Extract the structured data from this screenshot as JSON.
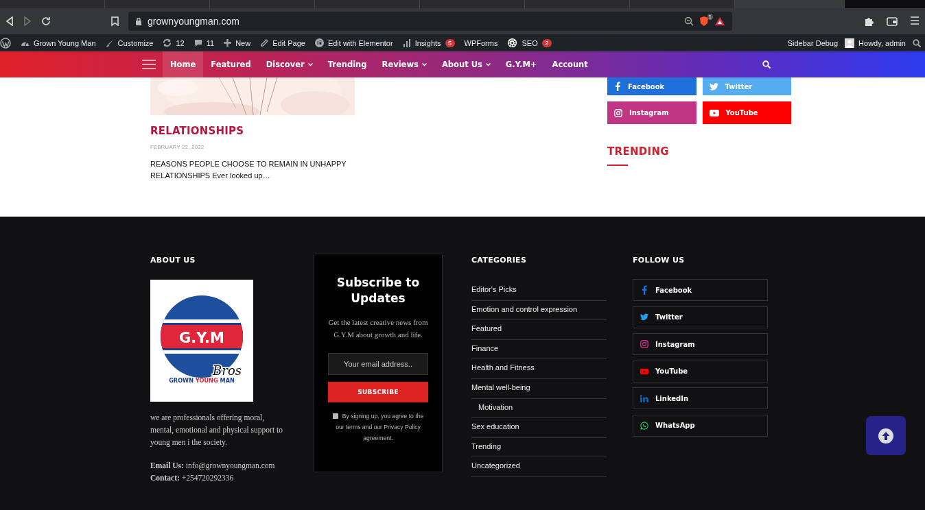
{
  "browser": {
    "tabs": [
      {
        "selected": false
      },
      {
        "selected": false
      },
      {
        "selected": false
      },
      {
        "selected": false
      },
      {
        "selected": false
      },
      {
        "selected": false
      },
      {
        "selected": false
      },
      {
        "selected": true
      }
    ],
    "address": "grownyoungman.com",
    "shield_badge": "1"
  },
  "admin_bar": {
    "items": [
      {
        "kind": "wordpress"
      },
      {
        "kind": "gauge",
        "label": "Grown Young Man"
      },
      {
        "kind": "brush",
        "label": "Customize"
      },
      {
        "kind": "refresh",
        "label": "12"
      },
      {
        "kind": "comment",
        "label": "11"
      },
      {
        "kind": "plus",
        "label": "New"
      },
      {
        "kind": "pencil",
        "label": "Edit Page"
      },
      {
        "kind": "elementor",
        "label": "Edit with Elementor"
      },
      {
        "kind": "bars",
        "label": "Insights",
        "badge": "5"
      },
      {
        "label": "WPForms"
      },
      {
        "kind": "seo",
        "label": "SEO",
        "badge": "2"
      }
    ],
    "right": [
      {
        "label": "Sidebar Debug"
      },
      {
        "label": "Howdy, admin",
        "kind": "avatar"
      },
      {
        "kind": "search"
      }
    ]
  },
  "nav": {
    "items": [
      {
        "label": "Home",
        "selected": true,
        "dropdown": false
      },
      {
        "label": "Featured",
        "selected": false,
        "dropdown": false
      },
      {
        "label": "Discover",
        "selected": false,
        "dropdown": true
      },
      {
        "label": "Trending",
        "selected": false,
        "dropdown": false
      },
      {
        "label": "Reviews",
        "selected": false,
        "dropdown": true
      },
      {
        "label": "About Us",
        "selected": false,
        "dropdown": true
      },
      {
        "label": "G.Y.M+",
        "selected": false,
        "dropdown": false
      },
      {
        "label": "Account",
        "selected": false,
        "dropdown": false
      }
    ]
  },
  "post": {
    "category": "RELATIONSHIPS",
    "date": "FEBRUARY 22, 2022",
    "excerpt": "REASONS PEOPLE CHOOSE TO REMAIN IN UNHAPPY RELATIONSHIPS Ever looked up…"
  },
  "sidebar": {
    "social": [
      {
        "kind": "facebook",
        "label": "Facebook",
        "color": "#1e6fd9"
      },
      {
        "kind": "twitter",
        "label": "Twitter",
        "color": "#55acee"
      },
      {
        "kind": "instagram",
        "label": "Instagram",
        "color": "#c13584"
      },
      {
        "kind": "youtube",
        "label": "YouTube",
        "color": "#ff0000"
      }
    ],
    "heading": "TRENDING"
  },
  "footer": {
    "about": {
      "heading": "ABOUT US",
      "logo": {
        "initials": "G.Y.M",
        "script": "Bros",
        "name": [
          "GROWN",
          "YOUNG",
          "MAN"
        ]
      },
      "description": "we are professionals offering moral, mental, emotional and physical support to young men i the society.",
      "email": "**Email Us:** info@grownyoungman.com",
      "contact": "**Contact:** +254720292336"
    },
    "subscribe": {
      "title": "Subscribe to Updates",
      "text": "Get the latest creative news from G.Y.M about growth and life.",
      "placeholder": "Your email address..",
      "button": "SUBSCRIBE",
      "consent": "By signing up, you agree to the our terms and our Privacy Policy agreement.",
      "checked": false
    },
    "categories": {
      "heading": "CATEGORIES",
      "items": [
        {
          "label": "Editor's Picks"
        },
        {
          "label": "Emotion and control expression"
        },
        {
          "label": "Featured"
        },
        {
          "label": "Finance"
        },
        {
          "label": "Health and Fitness"
        },
        {
          "label": "Mental well-being",
          "children": [
            {
              "label": "Motivation"
            }
          ]
        },
        {
          "label": "Sex education"
        },
        {
          "label": "Trending"
        },
        {
          "label": "Uncategorized"
        }
      ]
    },
    "follow": {
      "heading": "FOLLOW US",
      "items": [
        {
          "kind": "facebook",
          "label": "Facebook"
        },
        {
          "kind": "twitter",
          "label": "Twitter"
        },
        {
          "kind": "instagram",
          "label": "Instagram"
        },
        {
          "kind": "youtube",
          "label": "YouTube"
        },
        {
          "kind": "linkedin",
          "label": "LinkedIn"
        },
        {
          "kind": "whatsapp",
          "label": "WhatsApp"
        }
      ]
    }
  }
}
